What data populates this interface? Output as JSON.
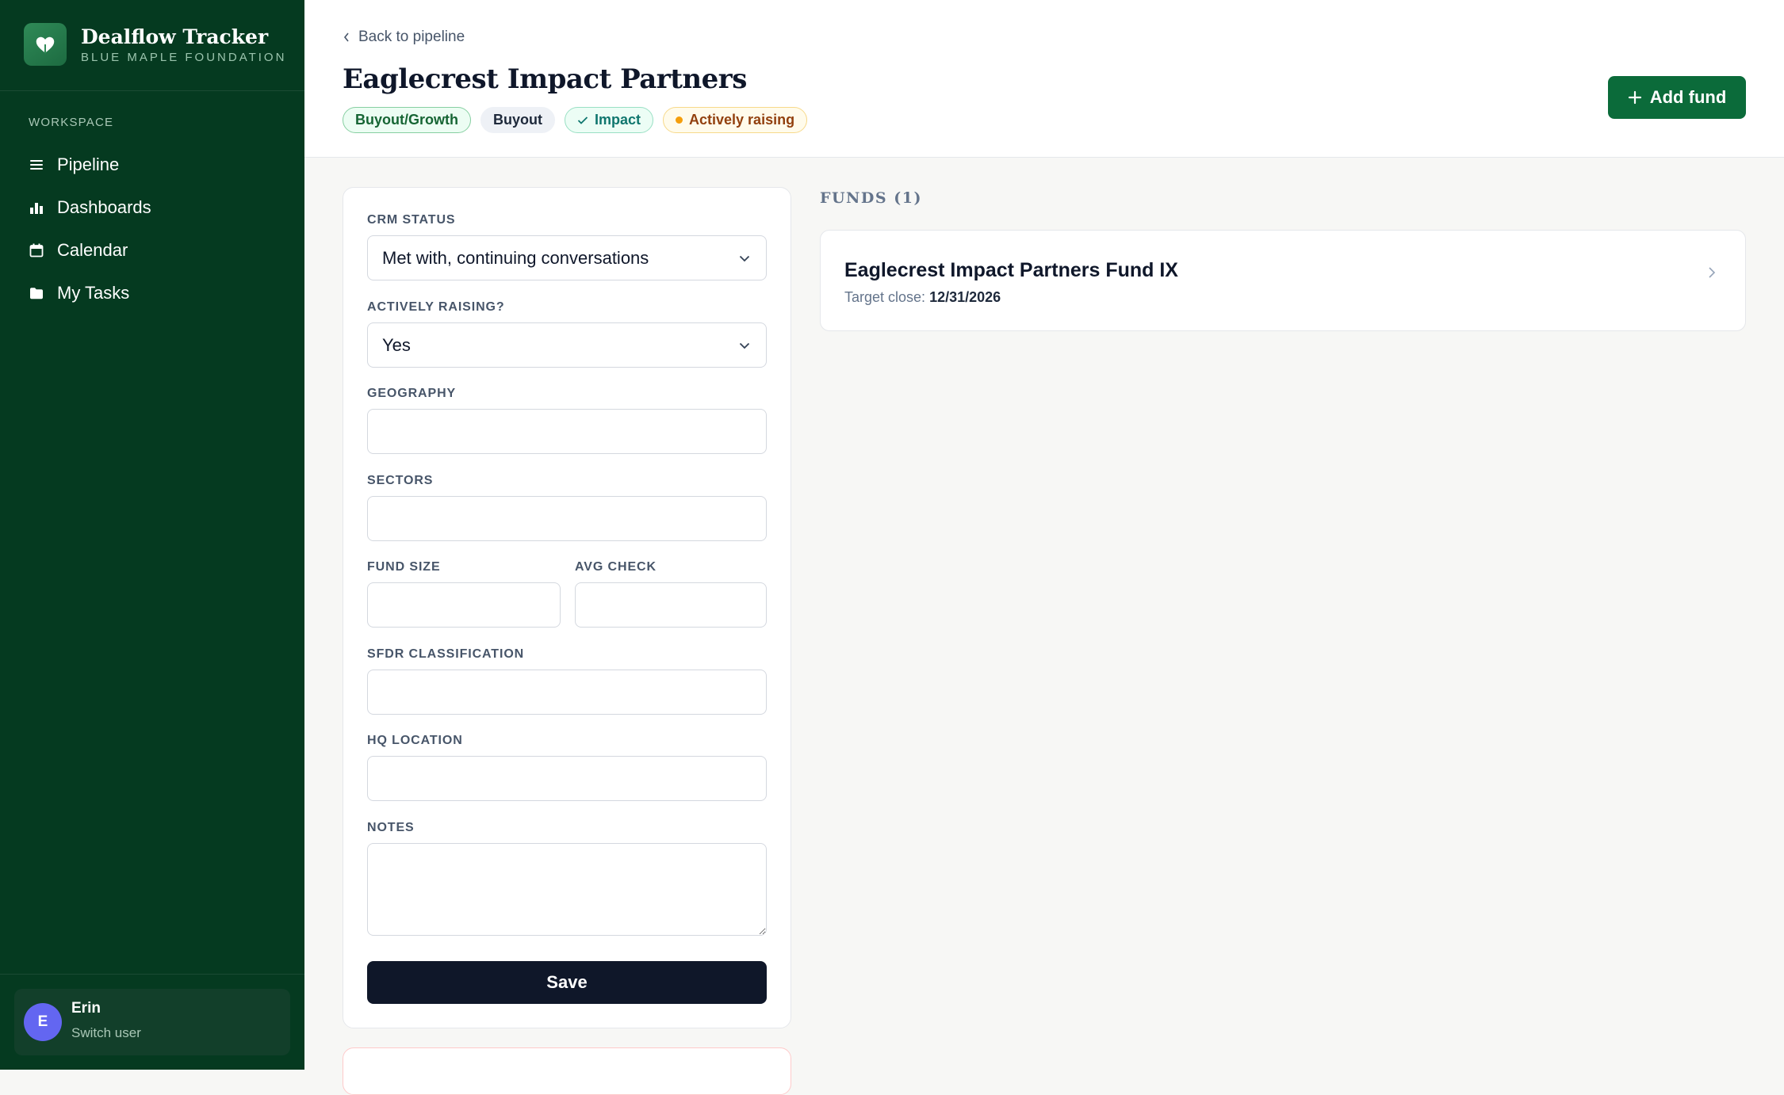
{
  "brand": {
    "title": "Dealflow Tracker",
    "subtitle": "BLUE MAPLE FOUNDATION"
  },
  "sidebar": {
    "section_label": "WORKSPACE",
    "items": [
      {
        "label": "Pipeline",
        "icon": "list-icon"
      },
      {
        "label": "Dashboards",
        "icon": "bar-chart-icon"
      },
      {
        "label": "Calendar",
        "icon": "calendar-icon"
      },
      {
        "label": "My Tasks",
        "icon": "folder-icon"
      }
    ],
    "user": {
      "initial": "E",
      "name": "Erin",
      "action": "Switch user"
    }
  },
  "header": {
    "back_label": "Back to pipeline",
    "title": "Eaglecrest Impact Partners",
    "tags": [
      "Buyout/Growth",
      "Buyout",
      "Impact",
      "Actively raising"
    ],
    "add_fund_label": "Add fund"
  },
  "form": {
    "crm_status": {
      "label": "CRM STATUS",
      "value": "Met with, continuing conversations"
    },
    "actively_raising": {
      "label": "ACTIVELY RAISING?",
      "value": "Yes"
    },
    "geography": {
      "label": "GEOGRAPHY",
      "value": ""
    },
    "sectors": {
      "label": "SECTORS",
      "value": ""
    },
    "fund_size": {
      "label": "FUND SIZE",
      "value": ""
    },
    "avg_check": {
      "label": "AVG CHECK",
      "value": ""
    },
    "sfdr": {
      "label": "SFDR CLASSIFICATION",
      "value": ""
    },
    "hq_location": {
      "label": "HQ LOCATION",
      "value": ""
    },
    "notes": {
      "label": "NOTES",
      "value": ""
    },
    "save_label": "Save"
  },
  "funds": {
    "heading": "FUNDS (1)",
    "items": [
      {
        "name": "Eaglecrest Impact Partners Fund IX",
        "close_label": "Target close:",
        "close_date": "12/31/2026"
      }
    ]
  },
  "colors": {
    "sidebar_bg": "#053a20",
    "accent_green": "#0b6b3a",
    "save_button": "#0f1729",
    "avatar": "#6366f1",
    "raising_dot": "#f59e0b"
  }
}
